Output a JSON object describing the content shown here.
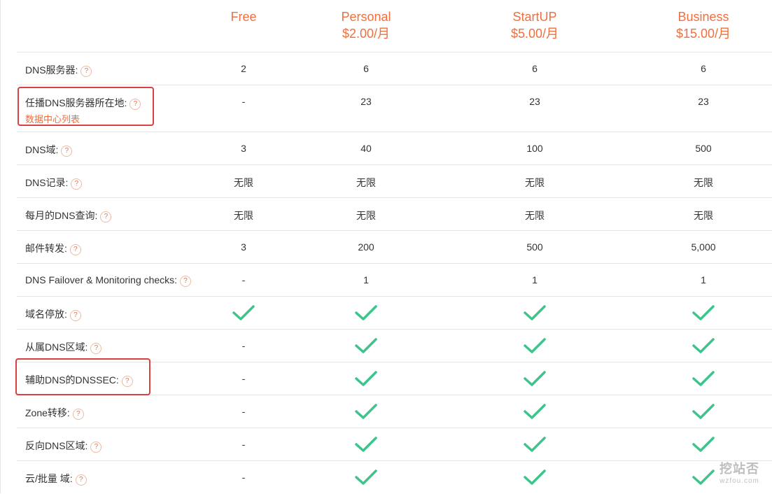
{
  "plans": [
    {
      "name": "Free",
      "price": ""
    },
    {
      "name": "Personal",
      "price": "$2.00/月"
    },
    {
      "name": "StartUP",
      "price": "$5.00/月"
    },
    {
      "name": "Business",
      "price": "$15.00/月"
    }
  ],
  "help_glyph": "?",
  "rows": [
    {
      "label": "DNS服务器:",
      "values": [
        "2",
        "6",
        "6",
        "6"
      ]
    },
    {
      "label": "任播DNS服务器所在地:",
      "sublink": "数据中心列表",
      "values": [
        "-",
        "23",
        "23",
        "23"
      ]
    },
    {
      "label": "DNS域:",
      "values": [
        "3",
        "40",
        "100",
        "500"
      ]
    },
    {
      "label": "DNS记录:",
      "values": [
        "无限",
        "无限",
        "无限",
        "无限"
      ]
    },
    {
      "label": "每月的DNS查询:",
      "values": [
        "无限",
        "无限",
        "无限",
        "无限"
      ]
    },
    {
      "label": "邮件转发:",
      "values": [
        "3",
        "200",
        "500",
        "5,000"
      ]
    },
    {
      "label": "DNS Failover & Monitoring checks:",
      "values": [
        "-",
        "1",
        "1",
        "1"
      ]
    },
    {
      "label": "域名停放:",
      "values": [
        "check",
        "check",
        "check",
        "check"
      ]
    },
    {
      "label": "从属DNS区域:",
      "values": [
        "-",
        "check",
        "check",
        "check"
      ]
    },
    {
      "label": "辅助DNS的DNSSEC:",
      "values": [
        "-",
        "check",
        "check",
        "check"
      ]
    },
    {
      "label": "Zone转移:",
      "values": [
        "-",
        "check",
        "check",
        "check"
      ]
    },
    {
      "label": "反向DNS区域:",
      "values": [
        "-",
        "check",
        "check",
        "check"
      ]
    },
    {
      "label": "云/批量 域:",
      "values": [
        "-",
        "check",
        "check",
        "check"
      ]
    }
  ],
  "watermark": {
    "name": "挖站否",
    "url": "wzfou.com"
  },
  "colors": {
    "accent": "#ef6f3e",
    "check": "#3cc48a",
    "highlight": "#d9403f",
    "border": "#e6e6e6"
  }
}
